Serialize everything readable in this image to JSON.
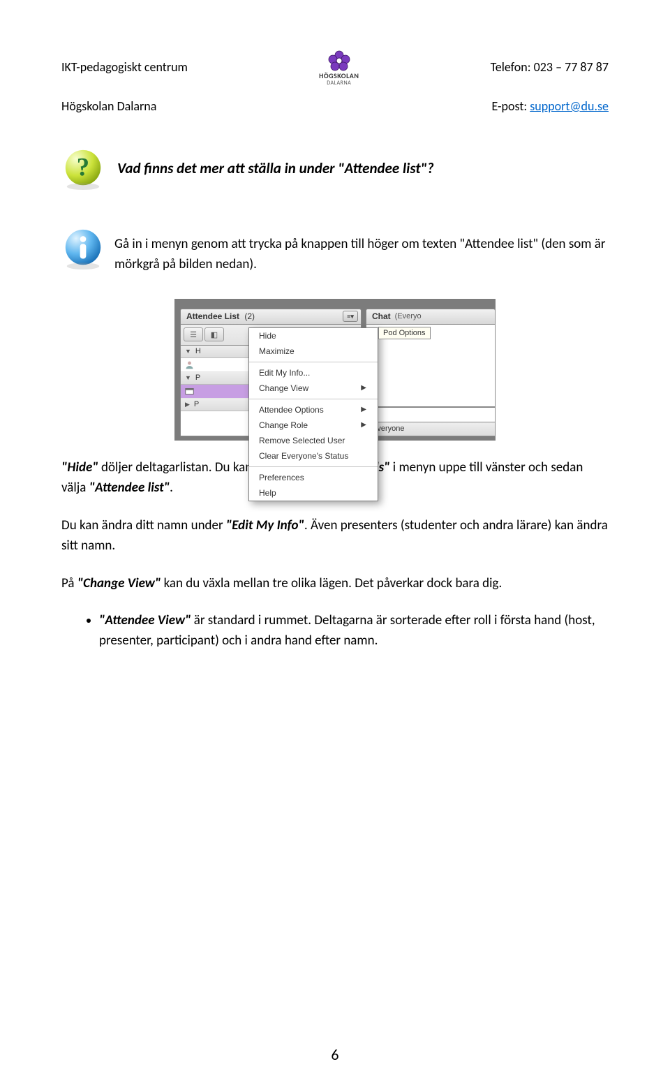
{
  "header": {
    "org": "IKT-pedagogiskt centrum",
    "phone_label": "Telefon: 023 – 77 87 87",
    "school": "Högskolan Dalarna",
    "email_label": "E-post: ",
    "email_link": "support@du.se",
    "logo_top": "HÖGSKOLAN",
    "logo_bottom": "DALARNA"
  },
  "title": "Vad finns det mer att ställa in under \"Attendee list\"?",
  "intro": "Gå in i menyn genom att trycka på knappen till höger om texten \"Attendee list\" (den som är mörkgrå på bilden nedan).",
  "para1_a": "\"Hide\"",
  "para1_b": " döljer deltagarlistan. Du kan få tillbaka den via ",
  "para1_c": "\"Pods\"",
  "para1_d": " i menyn uppe till vänster och sedan välja ",
  "para1_e": "\"Attendee list\"",
  "para1_f": ".",
  "para2_a": "Du kan ändra ditt namn under ",
  "para2_b": "\"Edit My Info\"",
  "para2_c": ". Även presenters (studenter och andra lärare) kan ändra sitt namn.",
  "para3_a": "På ",
  "para3_b": "\"Change View\"",
  "para3_c": " kan du växla mellan tre olika lägen. Det påverkar dock bara dig.",
  "bullet_a": "\"Attendee View\"",
  "bullet_b": " är standard i rummet. Deltagarna är sorterade efter roll i första hand (host, presenter, participant) och i andra hand efter namn.",
  "page_number": "6",
  "shot": {
    "attendee_title": "Attendee List",
    "attendee_count": "(2)",
    "chat_title": "Chat",
    "chat_sub": "(Everyo",
    "tooltip": "Pod Options",
    "role_h": "H",
    "role_p": "P",
    "everyone_tab": "Everyone",
    "menu": {
      "hide": "Hide",
      "maximize": "Maximize",
      "edit": "Edit My Info...",
      "changeview": "Change View",
      "attoptions": "Attendee Options",
      "changerole": "Change Role",
      "remove": "Remove Selected User",
      "clear": "Clear Everyone's Status",
      "prefs": "Preferences",
      "help": "Help"
    }
  }
}
